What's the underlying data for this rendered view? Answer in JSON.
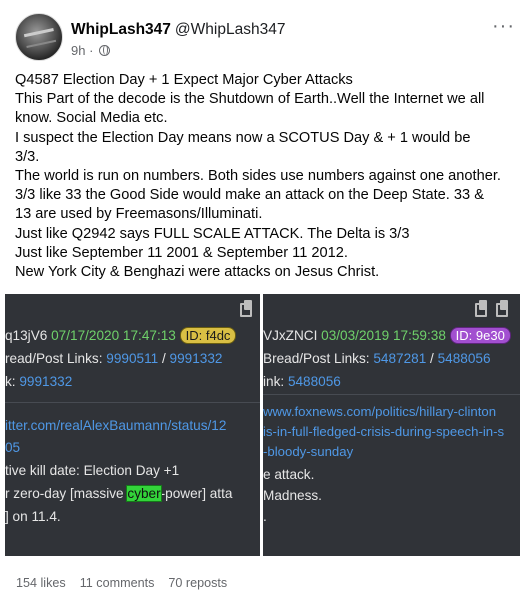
{
  "post": {
    "author_name": "WhipLash347",
    "author_handle": "@WhipLash347",
    "time": "9h",
    "lines": [
      "Q4587 Election Day + 1 Expect Major Cyber Attacks",
      "This Part of the decode is the Shutdown of Earth..Well the Internet we all",
      "know. Social Media etc.",
      "I suspect the Election Day means now a SCOTUS Day & + 1 would be",
      "3/3.",
      "The world is run on numbers. Both sides use numbers against one another.",
      "3/3 like 33 the Good Side would make an attack on the Deep State. 33 &",
      "13 are used by Freemasons/Illuminati.",
      "Just like Q2942 says FULL SCALE ATTACK. The Delta is 3/3",
      "Just like September 11 2001 & September 11 2012.",
      "New York City & Benghazi were attacks on Jesus Christ."
    ]
  },
  "image_left": {
    "id_prefix": "q13jV6",
    "date": "07/17/2020 17:47:13",
    "badge": "ID: f4dc",
    "bread_label": "read/Post Links:",
    "link1": "9990511",
    "slash": "/",
    "link2": "9991332",
    "k_label": "k:",
    "k_link": "9991332",
    "url_line1": "itter.com/realAlexBaumann/status/12",
    "url_line2": "05",
    "text1": "tive kill date: Election Day +1",
    "text2_pre": "r zero-day [massive ",
    "text2_hl": "cyber",
    "text2_post": "-power] atta",
    "text3": "] on 11.4."
  },
  "image_right": {
    "id_prefix": "VJxZNCI",
    "date": "03/03/2019 17:59:38",
    "badge": "ID: 9e30",
    "bread_label": "Bread/Post Links:",
    "link1": "5487281",
    "slash": "/",
    "link2": "5488056",
    "k_label": "ink:",
    "k_link": "5488056",
    "url_line1": "www.foxnews.com/politics/hillary-clinton",
    "url_line2": "is-in-full-fledged-crisis-during-speech-in-s",
    "url_line3": "-bloody-sunday",
    "text1": "e attack.",
    "text2": "Madness.",
    "text3": "."
  },
  "stats": {
    "likes": "154 likes",
    "comments": "11 comments",
    "reposts": "70 reposts"
  },
  "icons": {
    "more": "more-icon",
    "globe": "globe-icon",
    "copy": "copy-icon"
  },
  "colors": {
    "panel_bg": "#303338",
    "date_green": "#6fd16a",
    "link_blue": "#4f98e6",
    "badge_yellow": "#d9bf44",
    "badge_purple": "#a24fd0",
    "highlight_green": "#33d43a"
  }
}
